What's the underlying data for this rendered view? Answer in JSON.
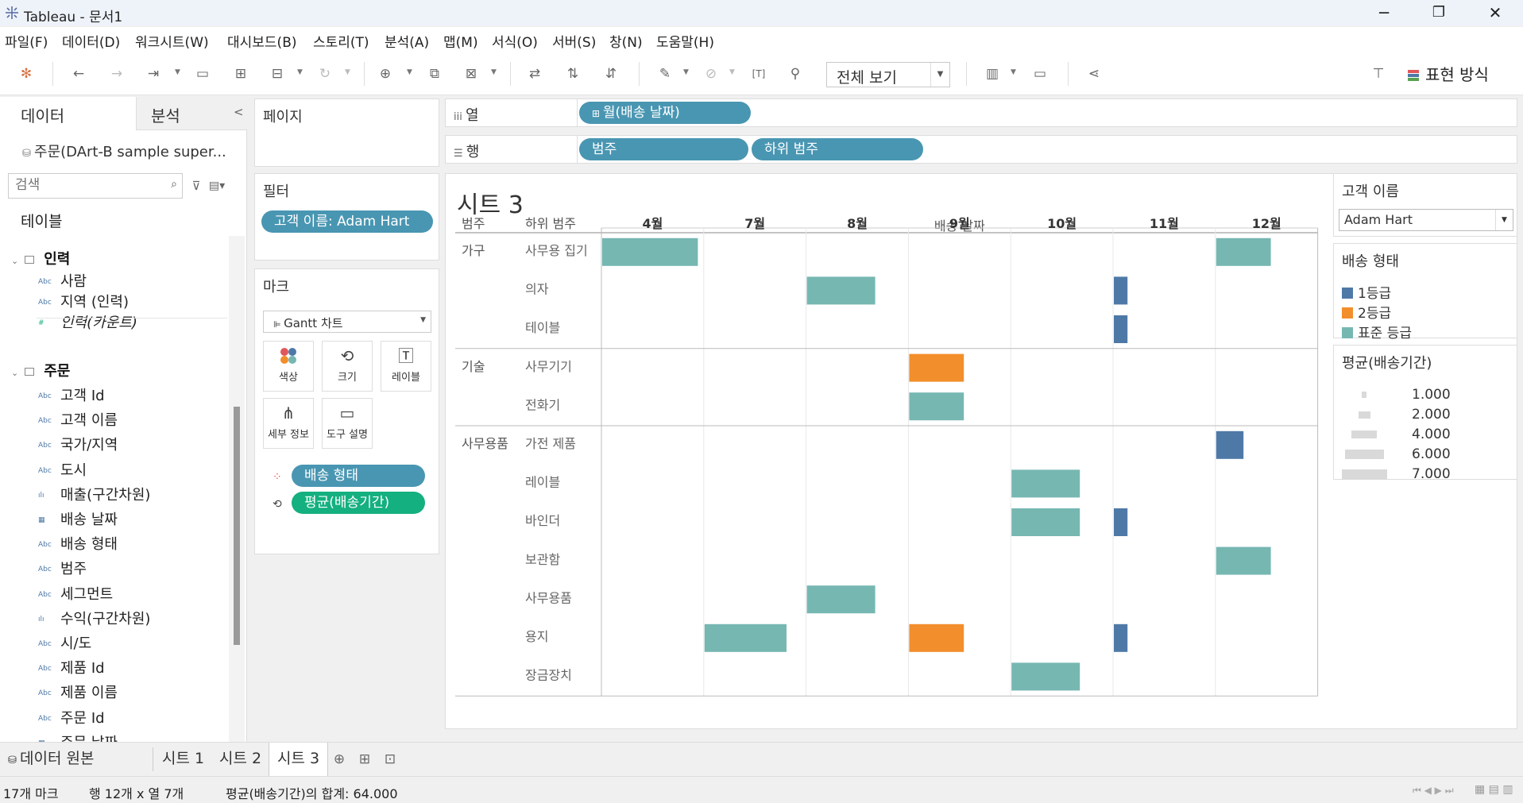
{
  "window": {
    "title": "Tableau - 문서1",
    "controls": {
      "minimize": "─",
      "restore": "❐",
      "close": "✕"
    }
  },
  "menu": [
    "파일(F)",
    "데이터(D)",
    "워크시트(W)",
    "대시보드(B)",
    "스토리(T)",
    "분석(A)",
    "맵(M)",
    "서식(O)",
    "서버(S)",
    "창(N)",
    "도움말(H)"
  ],
  "toolbar": {
    "fit_view": "전체 보기",
    "show_me": "표현 방식"
  },
  "data_pane": {
    "tab_data": "데이터",
    "tab_analysis": "분석",
    "collapse": "<",
    "datasource": "주문(DArt-B sample super...",
    "search_placeholder": "검색",
    "tables_label": "테이블",
    "group_people": "인력",
    "people_fields": [
      {
        "icon": "Abc",
        "name": "사람"
      },
      {
        "icon": "Abc",
        "name": "지역 (인력)"
      },
      {
        "icon": "#",
        "name": "인력(카운트)"
      }
    ],
    "group_orders": "주문",
    "order_fields": [
      {
        "icon": "Abc",
        "name": "고객 Id"
      },
      {
        "icon": "Abc",
        "name": "고객 이름"
      },
      {
        "icon": "Abc",
        "name": "국가/지역"
      },
      {
        "icon": "Abc",
        "name": "도시"
      },
      {
        "icon": "ılı",
        "name": "매출(구간차원)"
      },
      {
        "icon": "▦",
        "name": "배송 날짜"
      },
      {
        "icon": "Abc",
        "name": "배송 형태"
      },
      {
        "icon": "Abc",
        "name": "범주"
      },
      {
        "icon": "Abc",
        "name": "세그먼트"
      },
      {
        "icon": "ılı",
        "name": "수익(구간차원)"
      },
      {
        "icon": "Abc",
        "name": "시/도"
      },
      {
        "icon": "Abc",
        "name": "제품 Id"
      },
      {
        "icon": "Abc",
        "name": "제품 이름"
      },
      {
        "icon": "Abc",
        "name": "주문 Id"
      },
      {
        "icon": "▦",
        "name": "주문 날짜"
      }
    ]
  },
  "pages_card": {
    "title": "페이지"
  },
  "filters_card": {
    "title": "필터",
    "filter_pill": "고객 이름: Adam Hart"
  },
  "marks_card": {
    "title": "마크",
    "mark_type": "Gantt 차트",
    "buttons": {
      "color": "색상",
      "size": "크기",
      "label": "레이블",
      "detail": "세부 정보",
      "tooltip": "도구 설명"
    },
    "pill_color": "배송 형태",
    "pill_size": "평균(배송기간)"
  },
  "shelves": {
    "columns_label": "열",
    "columns_pill": "월(배송 날짜)",
    "rows_label": "행",
    "rows_pills": [
      "범주",
      "하위 범주"
    ]
  },
  "sheet": {
    "title": "시트 3"
  },
  "chart_data": {
    "type": "gantt",
    "x_header": "배송 날짜",
    "row_headers": [
      "범주",
      "하위 범주"
    ],
    "columns": [
      "4월",
      "7월",
      "8월",
      "9월",
      "10월",
      "11월",
      "12월"
    ],
    "rows": [
      {
        "category": "가구",
        "sub": "사무용 집기"
      },
      {
        "category": "",
        "sub": "의자"
      },
      {
        "category": "",
        "sub": "테이블"
      },
      {
        "category": "기술",
        "sub": "사무기기"
      },
      {
        "category": "",
        "sub": "전화기"
      },
      {
        "category": "사무용품",
        "sub": "가전 제품"
      },
      {
        "category": "",
        "sub": "레이블"
      },
      {
        "category": "",
        "sub": "바인더"
      },
      {
        "category": "",
        "sub": "보관함"
      },
      {
        "category": "",
        "sub": "사무용품"
      },
      {
        "category": "",
        "sub": "용지"
      },
      {
        "category": "",
        "sub": "장금장치"
      }
    ],
    "marks": [
      {
        "row": 0,
        "col": 0,
        "ship_mode": "표준 등급",
        "avg_days": 7
      },
      {
        "row": 0,
        "col": 6,
        "ship_mode": "표준 등급",
        "avg_days": 4
      },
      {
        "row": 1,
        "col": 2,
        "ship_mode": "표준 등급",
        "avg_days": 5
      },
      {
        "row": 1,
        "col": 5,
        "ship_mode": "1등급",
        "avg_days": 1
      },
      {
        "row": 2,
        "col": 5,
        "ship_mode": "1등급",
        "avg_days": 1
      },
      {
        "row": 3,
        "col": 3,
        "ship_mode": "2등급",
        "avg_days": 4
      },
      {
        "row": 4,
        "col": 3,
        "ship_mode": "표준 등급",
        "avg_days": 4
      },
      {
        "row": 5,
        "col": 6,
        "ship_mode": "1등급",
        "avg_days": 2
      },
      {
        "row": 6,
        "col": 4,
        "ship_mode": "표준 등급",
        "avg_days": 5
      },
      {
        "row": 7,
        "col": 4,
        "ship_mode": "표준 등급",
        "avg_days": 5
      },
      {
        "row": 7,
        "col": 5,
        "ship_mode": "1등급",
        "avg_days": 1
      },
      {
        "row": 8,
        "col": 6,
        "ship_mode": "표준 등급",
        "avg_days": 4
      },
      {
        "row": 9,
        "col": 2,
        "ship_mode": "표준 등급",
        "avg_days": 5
      },
      {
        "row": 10,
        "col": 1,
        "ship_mode": "표준 등급",
        "avg_days": 6
      },
      {
        "row": 10,
        "col": 3,
        "ship_mode": "2등급",
        "avg_days": 4
      },
      {
        "row": 10,
        "col": 5,
        "ship_mode": "1등급",
        "avg_days": 1
      },
      {
        "row": 11,
        "col": 4,
        "ship_mode": "표준 등급",
        "avg_days": 5
      }
    ],
    "colors": {
      "1등급": "#4e79a7",
      "2등급": "#f28e2b",
      "표준 등급": "#76b7b2"
    }
  },
  "legends": {
    "customer_title": "고객 이름",
    "customer_value": "Adam Hart",
    "ship_title": "배송 형태",
    "ship_items": [
      {
        "label": "1등급",
        "color": "#4e79a7"
      },
      {
        "label": "2등급",
        "color": "#f28e2b"
      },
      {
        "label": "표준 등급",
        "color": "#76b7b2"
      }
    ],
    "size_title": "평균(배송기간)",
    "size_items": [
      "1.000",
      "2.000",
      "4.000",
      "6.000",
      "7.000"
    ]
  },
  "sheet_tabs": {
    "datasource_tab": "데이터 원본",
    "tabs": [
      "시트 1",
      "시트 2",
      "시트 3"
    ]
  },
  "status": {
    "marks": "17개 마크",
    "dims": "행 12개  x  열 7개",
    "sum": "평균(배송기간)의 합계: 64.000"
  }
}
